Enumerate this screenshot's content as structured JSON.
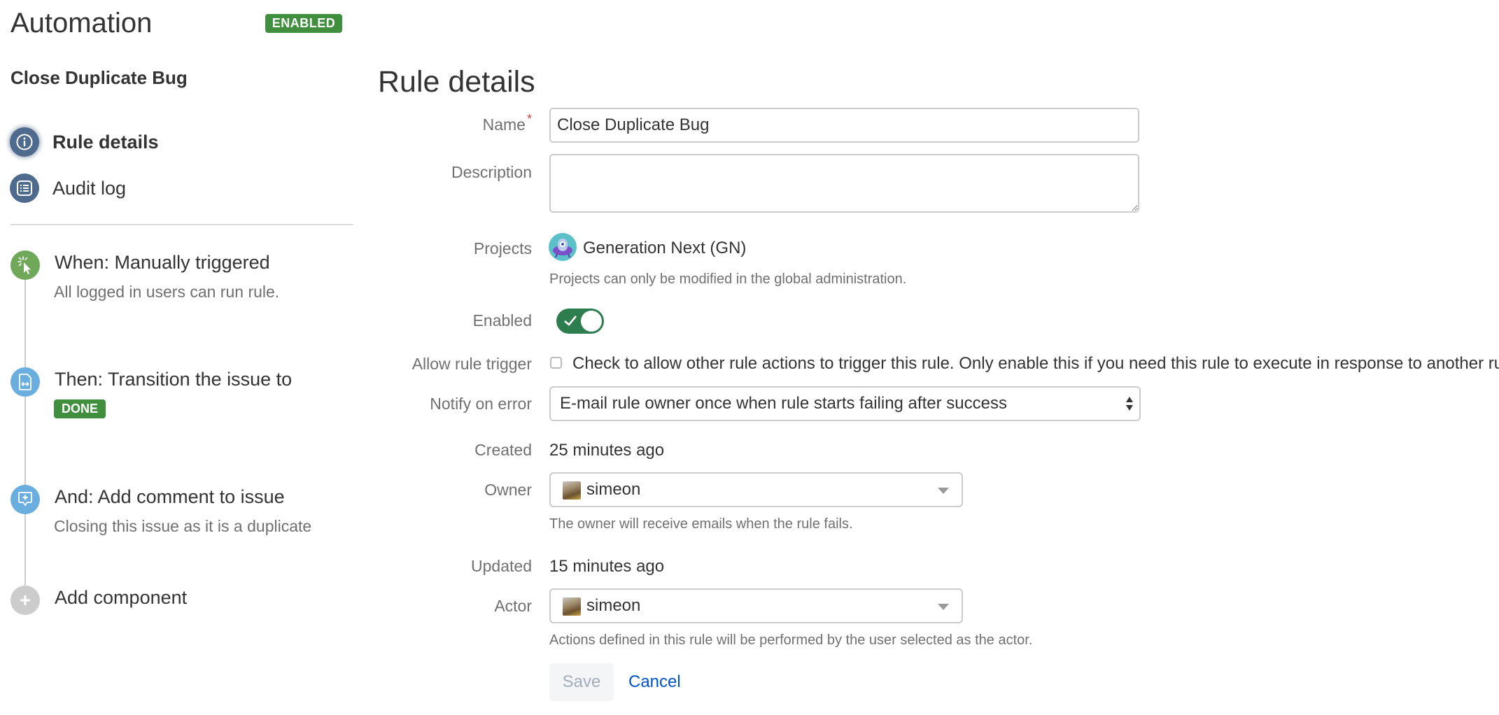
{
  "app": {
    "title": "Automation",
    "status_badge": "ENABLED"
  },
  "sidebar": {
    "rule_name": "Close Duplicate Bug",
    "nav": [
      {
        "label": "Rule details",
        "icon": "info-icon",
        "active": true
      },
      {
        "label": "Audit log",
        "icon": "list-icon",
        "active": false
      }
    ],
    "components": [
      {
        "title": "When: Manually triggered",
        "subtitle": "All logged in users can run rule.",
        "icon": "cursor-click-icon",
        "color": "#70a85a"
      },
      {
        "title": "Then: Transition the issue to",
        "badge": "DONE",
        "icon": "transition-document-icon",
        "color": "#6aaee0"
      },
      {
        "title": "And: Add comment to issue",
        "subtitle": "Closing this issue as it is a duplicate",
        "icon": "add-comment-icon",
        "color": "#6aaee0"
      },
      {
        "title": "Add component",
        "icon": "plus-icon",
        "color": "#cccccc"
      }
    ]
  },
  "main": {
    "title": "Rule details",
    "fields": {
      "name": {
        "label": "Name",
        "required_marker": "*",
        "value": "Close Duplicate Bug"
      },
      "description": {
        "label": "Description",
        "value": ""
      },
      "projects": {
        "label": "Projects",
        "value": "Generation Next (GN)",
        "help": "Projects can only be modified in the global administration."
      },
      "enabled": {
        "label": "Enabled",
        "checked": true
      },
      "allow_rule_trigger": {
        "label": "Allow rule trigger",
        "checked": false,
        "text": "Check to allow other rule actions to trigger this rule. Only enable this if you need this rule to execute in response to another rule."
      },
      "notify_on_error": {
        "label": "Notify on error",
        "value": "E-mail rule owner once when rule starts failing after success"
      },
      "created": {
        "label": "Created",
        "value": "25 minutes ago"
      },
      "owner": {
        "label": "Owner",
        "value": "simeon",
        "help": "The owner will receive emails when the rule fails."
      },
      "updated": {
        "label": "Updated",
        "value": "15 minutes ago"
      },
      "actor": {
        "label": "Actor",
        "value": "simeon",
        "help": "Actions defined in this rule will be performed by the user selected as the actor."
      }
    },
    "actions": {
      "save": "Save",
      "cancel": "Cancel"
    }
  },
  "colors": {
    "badge_green": "#3f8f3f",
    "nav_icon": "#4e6a8c",
    "toggle_on": "#2e7d4f",
    "link": "#0052cc",
    "required": "#d04437"
  }
}
